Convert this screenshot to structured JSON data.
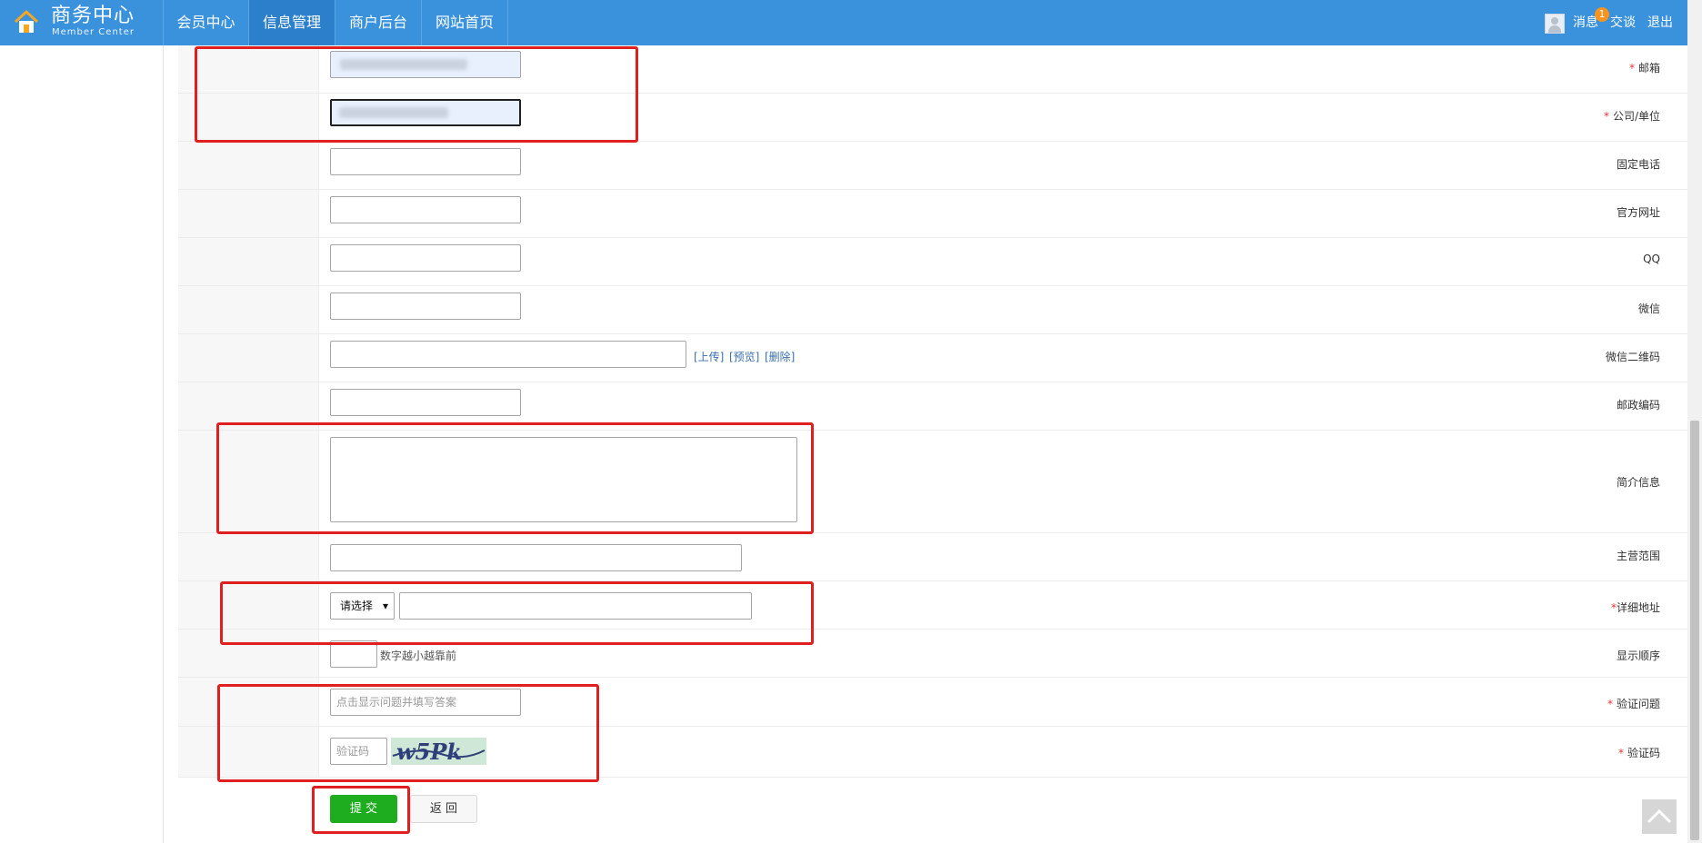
{
  "header": {
    "logo_title": "商务中心",
    "logo_subtitle": "Member Center",
    "nav": [
      "会员中心",
      "信息管理",
      "商户后台",
      "网站首页"
    ],
    "active_nav": "信息管理",
    "messages_label": "消息",
    "messages_badge": "1",
    "talk_label": "交谈",
    "logout_label": "退出"
  },
  "form": {
    "email": {
      "label": "邮箱",
      "required": "*"
    },
    "company": {
      "label": "公司/单位",
      "required": "*"
    },
    "phone": {
      "label": "固定电话"
    },
    "website": {
      "label": "官方网址"
    },
    "qq": {
      "label": "QQ"
    },
    "wechat": {
      "label": "微信"
    },
    "wechat_qr": {
      "label": "微信二维码",
      "upload": "[上传]",
      "preview": "[预览]",
      "delete": "[删除]"
    },
    "postcode": {
      "label": "邮政编码"
    },
    "intro": {
      "label": "简介信息"
    },
    "business_scope": {
      "label": "主营范围"
    },
    "address": {
      "label": "详细地址",
      "required": "*",
      "select_value": "请选择"
    },
    "display_order": {
      "label": "显示顺序",
      "hint": "数字越小越靠前"
    },
    "question": {
      "label": "验证问题",
      "required": "*",
      "placeholder": "点击显示问题并填写答案"
    },
    "captcha": {
      "label": "验证码",
      "required": "*",
      "placeholder": "验证码",
      "image_text": "w5Pk"
    }
  },
  "buttons": {
    "submit": "提 交",
    "back": "返 回"
  },
  "colors": {
    "header_bg": "#3a92dd",
    "active_nav_bg": "#2c7fcb",
    "submit_bg": "#1ead1e",
    "annotation_red": "#e02020"
  }
}
